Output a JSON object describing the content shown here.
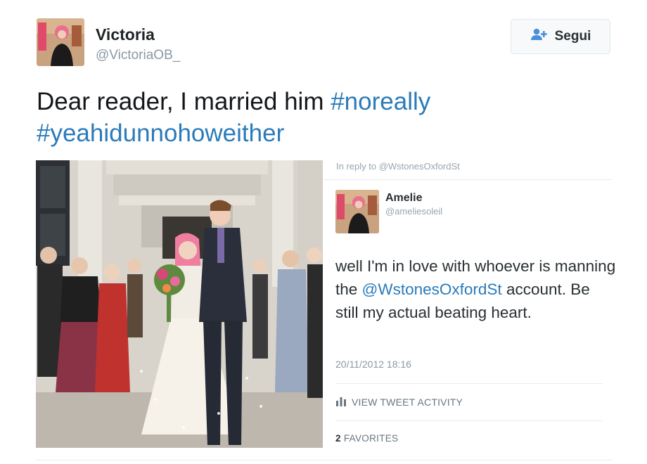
{
  "author": {
    "display_name": "Victoria",
    "handle": "@VictoriaOB_"
  },
  "follow_button": {
    "icon": "person-plus-icon",
    "label": "Segui"
  },
  "tweet": {
    "text_plain": "Dear reader, I married him ",
    "hashtag_1": "#noreally",
    "hashtag_2": "#yeahidunnohoweither"
  },
  "embedded_tweet": {
    "in_reply_to": "In reply to @WstonesOxfordSt",
    "display_name": "Amelie",
    "handle": "@ameliesoleil",
    "text_before": "well I'm in love with whoever is manning the ",
    "mention": "@WstonesOxfordSt",
    "text_after": " account. Be still my actual beating heart.",
    "timestamp": "20/11/2012 18:16",
    "activity_label": "VIEW TWEET ACTIVITY",
    "activity_icon": "bar-chart-icon",
    "favorites_count": "2",
    "favorites_label": "FAVORITES"
  },
  "colors": {
    "link": "#2b7bb9",
    "secondary_text": "#8899a6",
    "follow_icon": "#4a90d9"
  }
}
